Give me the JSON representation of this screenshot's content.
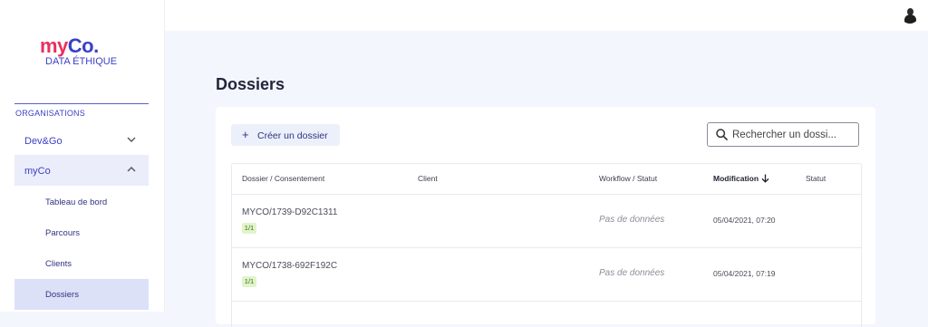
{
  "header": {
    "avatar_icon": "user-avatar-icon"
  },
  "brand": {
    "name_part1": "my",
    "name_part2": "Co.",
    "tagline": "DATA ÉTHIQUE",
    "color_primary": "#e8315f",
    "color_secondary": "#3a3fc5"
  },
  "sidebar": {
    "section_label": "ORGANISATIONS",
    "orgs": [
      {
        "label": "Dev&Go",
        "icon": "chevron-down-icon",
        "expanded": false
      },
      {
        "label": "myCo",
        "icon": "chevron-up-icon",
        "expanded": true
      }
    ],
    "items": [
      {
        "label": "Tableau de bord"
      },
      {
        "label": "Parcours"
      },
      {
        "label": "Clients"
      },
      {
        "label": "Dossiers",
        "active": true
      }
    ]
  },
  "main": {
    "title": "Dossiers",
    "create_label": "Créer un dossier",
    "search_placeholder": "Rechercher un dossi...",
    "table": {
      "columns": [
        "Dossier / Consentement",
        "Client",
        "Workflow / Statut",
        "Modification",
        "Statut"
      ],
      "sort_column": "Modification",
      "rows": [
        {
          "id": "MYCO/1739-D92C1311",
          "badge": "1/1",
          "client": "",
          "workflow": "Pas de données",
          "modified": "05/04/2021, 07:20",
          "status": ""
        },
        {
          "id": "MYCO/1738-692F192C",
          "badge": "1/1",
          "client": "",
          "workflow": "Pas de données",
          "modified": "05/04/2021, 07:19",
          "status": ""
        }
      ]
    }
  }
}
